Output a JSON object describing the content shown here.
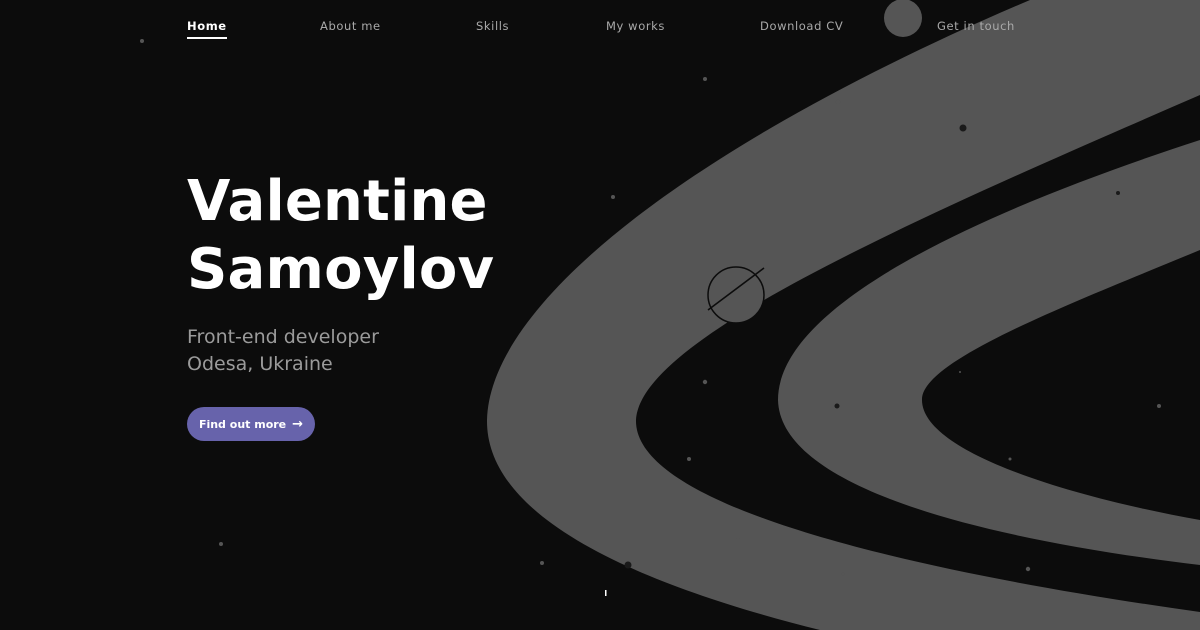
{
  "nav": {
    "items": [
      {
        "label": "Home",
        "active": true
      },
      {
        "label": "About me"
      },
      {
        "label": "Skills"
      },
      {
        "label": "My works"
      },
      {
        "label": "Download CV"
      },
      {
        "label": "Get in touch"
      }
    ]
  },
  "hero": {
    "name_line1": "Valentine",
    "name_line2": "Samoylov",
    "role": "Front-end developer",
    "location": "Odesa, Ukraine",
    "cta_label": "Find out more",
    "cta_icon": "arrow-right-icon"
  },
  "colors": {
    "background": "#0c0c0c",
    "ring": "#555555",
    "accent": "#6763ab",
    "text_primary": "#ffffff",
    "text_secondary": "#9b9b9b"
  }
}
